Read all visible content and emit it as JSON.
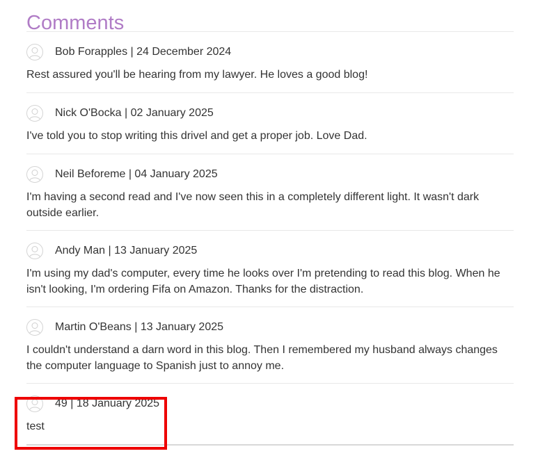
{
  "section": {
    "title": "Comments"
  },
  "comments": [
    {
      "author": "Bob Forapples",
      "date": "24 December 2024",
      "meta": "Bob Forapples | 24 December 2024",
      "text": "Rest assured you'll be hearing from my lawyer. He loves a good blog!"
    },
    {
      "author": "Nick O'Bocka",
      "date": "02 January 2025",
      "meta": "Nick O'Bocka | 02 January 2025",
      "text": "I've told you to stop writing this drivel and get a proper job. Love Dad."
    },
    {
      "author": "Neil Beforeme",
      "date": "04 January 2025",
      "meta": "Neil Beforeme | 04 January 2025",
      "text": "I'm having a second read and I've now seen this in a completely different light. It wasn't dark outside earlier."
    },
    {
      "author": "Andy Man",
      "date": "13 January 2025",
      "meta": "Andy Man | 13 January 2025",
      "text": "I'm using my dad's computer, every time he looks over I'm pretending to read this blog. When he isn't looking, I'm ordering Fifa on Amazon. Thanks for the distraction."
    },
    {
      "author": "Martin O'Beans",
      "date": "13 January 2025",
      "meta": "Martin O'Beans | 13 January 2025",
      "text": "I couldn't understand a darn word in this blog. Then I remembered my husband always changes the computer language to Spanish just to annoy me."
    },
    {
      "author": "49",
      "date": "18 January 2025",
      "meta": "49 | 18 January 2025",
      "text": "test"
    }
  ],
  "colors": {
    "title": "#b07cc6",
    "text": "#333333",
    "divider": "#e8e8e8",
    "highlight": "#ee0000"
  },
  "icons": {
    "avatar": "user-avatar-icon"
  }
}
